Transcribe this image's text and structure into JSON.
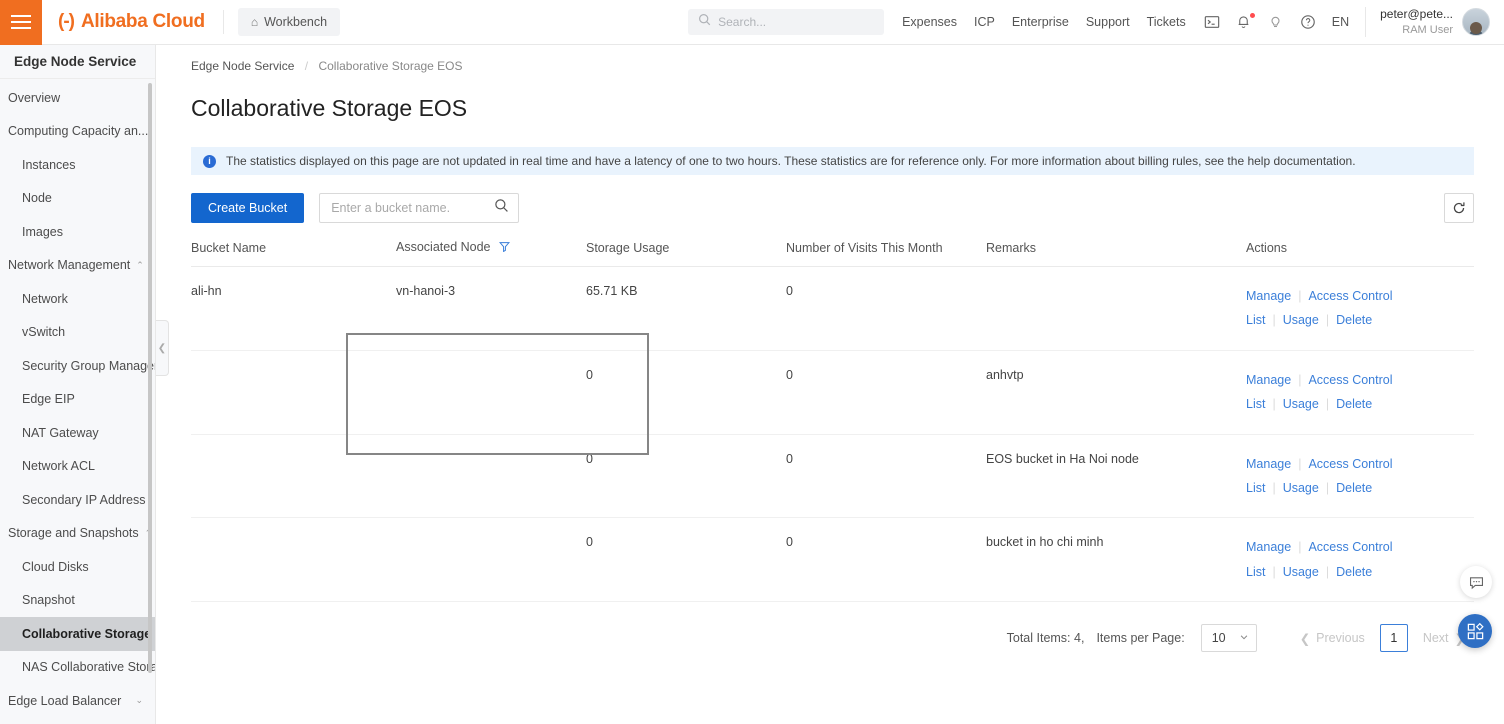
{
  "topbar": {
    "menu_icon": "hamburger-icon",
    "brand_mark": "(-)",
    "brand_name": "Alibaba Cloud",
    "workbench_label": "Workbench",
    "home_icon": "home-icon",
    "search_placeholder": "Search...",
    "search_value": "",
    "nav_links": [
      "Expenses",
      "ICP",
      "Enterprise",
      "Support",
      "Tickets"
    ],
    "icons": [
      "terminal-icon",
      "bell-icon",
      "lightbulb-icon",
      "help-circle-icon"
    ],
    "language": "EN",
    "user_name": "peter@pete...",
    "user_role": "RAM User"
  },
  "sidebar": {
    "title": "Edge Node Service",
    "items": [
      {
        "label": "Overview",
        "level": "group",
        "chevron": "",
        "active": false
      },
      {
        "label": "Computing Capacity an...",
        "level": "group",
        "chevron": "caret-up-icon",
        "active": false
      },
      {
        "label": "Instances",
        "level": "child",
        "chevron": "",
        "active": false
      },
      {
        "label": "Node",
        "level": "child",
        "chevron": "",
        "active": false
      },
      {
        "label": "Images",
        "level": "child",
        "chevron": "",
        "active": false
      },
      {
        "label": "Network Management",
        "level": "group",
        "chevron": "caret-up-icon",
        "active": false
      },
      {
        "label": "Network",
        "level": "child",
        "chevron": "",
        "active": false
      },
      {
        "label": "vSwitch",
        "level": "child",
        "chevron": "",
        "active": false
      },
      {
        "label": "Security Group Managem",
        "level": "child",
        "chevron": "",
        "active": false
      },
      {
        "label": "Edge EIP",
        "level": "child",
        "chevron": "",
        "active": false
      },
      {
        "label": "NAT Gateway",
        "level": "child",
        "chevron": "",
        "active": false
      },
      {
        "label": "Network ACL",
        "level": "child",
        "chevron": "",
        "active": false
      },
      {
        "label": "Secondary IP Address",
        "level": "child",
        "chevron": "",
        "active": false
      },
      {
        "label": "Storage and Snapshots",
        "level": "group",
        "chevron": "caret-up-icon",
        "active": false
      },
      {
        "label": "Cloud Disks",
        "level": "child",
        "chevron": "",
        "active": false
      },
      {
        "label": "Snapshot",
        "level": "child",
        "chevron": "",
        "active": false
      },
      {
        "label": "Collaborative Storage E(",
        "level": "child",
        "chevron": "",
        "active": true
      },
      {
        "label": "NAS Collaborative Storag",
        "level": "child",
        "chevron": "",
        "active": false
      },
      {
        "label": "Edge Load Balancer",
        "level": "group",
        "chevron": "caret-down-icon",
        "active": false
      }
    ],
    "collapse_icon": "chevron-left-icon"
  },
  "breadcrumb": {
    "root": "Edge Node Service",
    "separator": "/",
    "current": "Collaborative Storage EOS"
  },
  "page": {
    "title": "Collaborative Storage EOS",
    "info_banner": "The statistics displayed on this page are not updated in real time and have a latency of one to two hours. These statistics are for reference only. For more information about billing rules, see the help documentation."
  },
  "toolbar": {
    "create_label": "Create Bucket",
    "search_placeholder": "Enter a bucket name.",
    "search_value": "",
    "search_icon": "search-icon",
    "refresh_icon": "refresh-icon"
  },
  "table": {
    "columns": [
      "Bucket Name",
      "Associated Node",
      "Storage Usage",
      "Number of Visits This Month",
      "Remarks",
      "Actions"
    ],
    "filter_icon": "filter-icon",
    "actions": [
      "Manage",
      "Access Control List",
      "Usage",
      "Delete"
    ],
    "rows": [
      {
        "bucket_name": "ali-hn",
        "associated_node": "vn-hanoi-3",
        "storage_usage": "65.71 KB",
        "visits": "0",
        "remarks": ""
      },
      {
        "bucket_name": "",
        "associated_node": "",
        "storage_usage": "0",
        "visits": "0",
        "remarks": "anhvtp"
      },
      {
        "bucket_name": "",
        "associated_node": "",
        "storage_usage": "0",
        "visits": "0",
        "remarks": "EOS bucket in Ha Noi node"
      },
      {
        "bucket_name": "",
        "associated_node": "",
        "storage_usage": "0",
        "visits": "0",
        "remarks": "bucket in ho chi minh"
      }
    ]
  },
  "pagination": {
    "total_label": "Total Items: 4,",
    "per_page_label": "Items per Page:",
    "per_page_value": "10",
    "previous_label": "Previous",
    "current_page": "1",
    "next_label": "Next"
  },
  "floating": {
    "chat_icon": "chat-bubble-icon",
    "apps_icon": "apps-grid-icon"
  },
  "colors": {
    "brand_orange": "#f06e20",
    "primary_blue": "#1366ce",
    "link_blue": "#3b7fd9",
    "banner_bg": "#e9f3fd",
    "sidebar_bg": "#f7f8fa",
    "active_item_bg": "#cfd1d4",
    "highlight_border": "#868686"
  }
}
